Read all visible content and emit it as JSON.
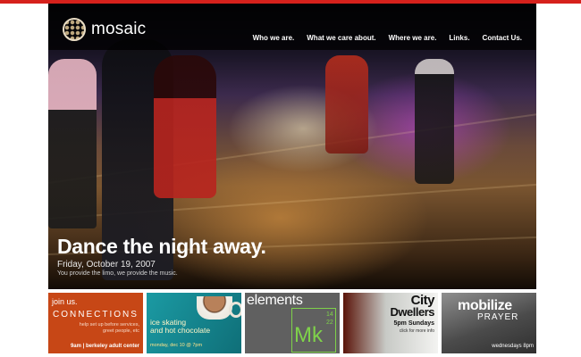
{
  "brand": {
    "name": "mosaic",
    "logo_icon": "mosaic-logo-icon"
  },
  "nav": {
    "items": [
      {
        "label": "Who we are."
      },
      {
        "label": "What we care about."
      },
      {
        "label": "Where we are."
      },
      {
        "label": "Links."
      },
      {
        "label": "Contact Us."
      }
    ]
  },
  "hero": {
    "headline": "Dance the night away.",
    "date": "Friday, October 19, 2007",
    "subtitle": "You provide the limo, we provide the music."
  },
  "tiles": [
    {
      "title": "join us.",
      "name": "CONNECTIONS",
      "desc_line1": "help set up before services,",
      "desc_line2": "greet people, etc",
      "footer": "9am  |  berkeley adult center"
    },
    {
      "title_line1": "ice skating",
      "title_line2": "and hot chocolate",
      "footer": "monday, dec 10 @ 7pm",
      "icon": "hot-chocolate-cup-icon"
    },
    {
      "title": "elements",
      "num1": "14",
      "num2": "22",
      "symbol": "Mk"
    },
    {
      "title_line1": "City",
      "title_line2": "Dwellers",
      "time": "5pm Sundays",
      "more": "click for more info"
    },
    {
      "title": "mobilize",
      "subtitle": "PRAYER",
      "time": "wednesdays 8pm"
    }
  ],
  "colors": {
    "top_bar": "#d6211c",
    "connections_bg": "#c74716",
    "ice_skating_bg": "#1b9aa3",
    "elements_bg": "#606060",
    "elements_accent": "#7fd24a"
  }
}
